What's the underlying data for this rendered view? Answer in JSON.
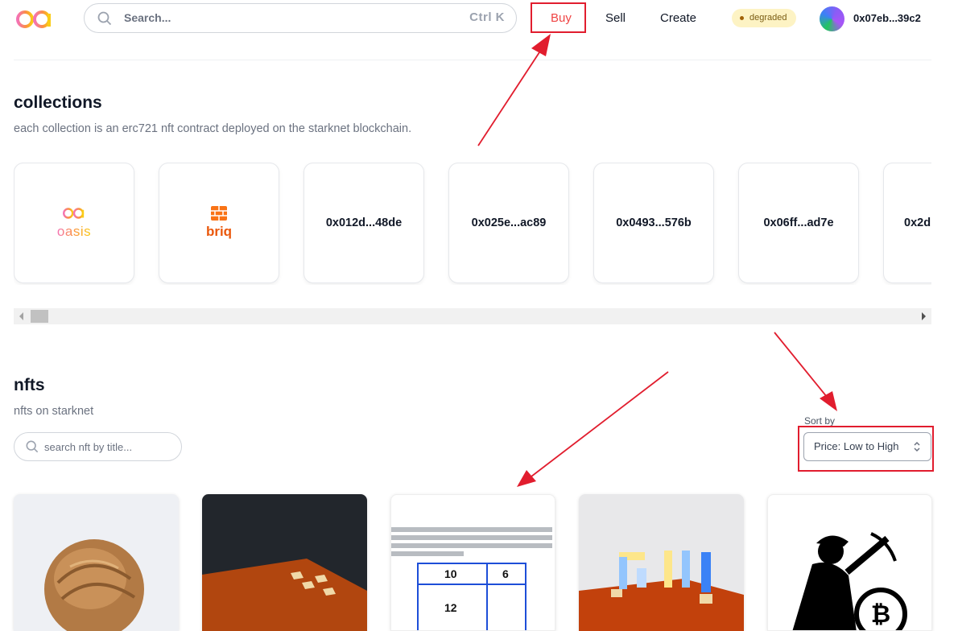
{
  "header": {
    "logo": "oa",
    "search_placeholder": "Search...",
    "search_shortcut": "Ctrl K",
    "nav": {
      "buy": "Buy",
      "sell": "Sell",
      "create": "Create"
    },
    "status_badge": "degraded",
    "wallet_address": "0x07eb...39c2"
  },
  "collections": {
    "title": "collections",
    "subtitle": "each collection is an erc721 nft contract deployed on the starknet blockchain.",
    "items": [
      {
        "label": "oasis",
        "icon": "oasis-logo-icon"
      },
      {
        "label": "briq",
        "icon": "brick-icon"
      },
      {
        "label": "0x012d...48de"
      },
      {
        "label": "0x025e...ac89"
      },
      {
        "label": "0x0493...576b"
      },
      {
        "label": "0x06ff...ad7e"
      },
      {
        "label": "0x2d"
      }
    ]
  },
  "nfts": {
    "title": "nfts",
    "subtitle": "nfts on starknet",
    "search_placeholder": "search nft by title...",
    "sort_label": "Sort by",
    "sort_value": "Price: Low to High",
    "cards": [
      {
        "image": "hair-bun-photo"
      },
      {
        "image": "voxel-blocks-render"
      },
      {
        "image": "math-problem-document",
        "cells": [
          "10",
          "6",
          "12"
        ]
      },
      {
        "image": "voxel-letters-render"
      },
      {
        "image": "bitcoin-miner-silhouette"
      }
    ]
  },
  "annotation_color": "#e11d2e"
}
